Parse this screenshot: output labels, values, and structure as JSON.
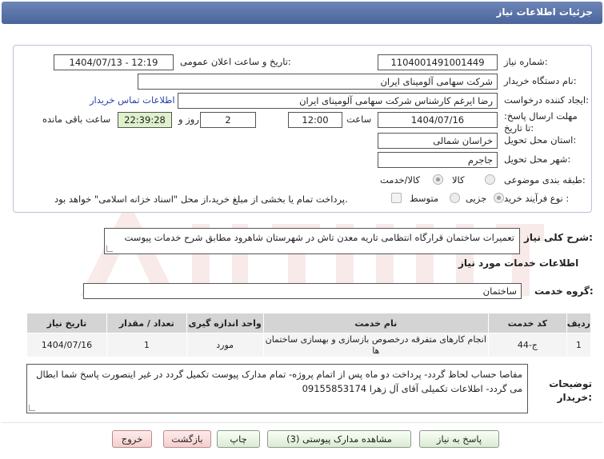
{
  "header": {
    "title": "جزئیات اطلاعات نیاز"
  },
  "form": {
    "need_number_label": "شماره نیاز:",
    "need_number": "1104001491001449",
    "announce_label": "تاریخ و ساعت اعلان عمومی:",
    "announce_value": "1404/07/13 - 12:19",
    "buyer_label": "نام دستگاه خریدار:",
    "buyer_value": "شرکت سهامی آلومینای ایران",
    "creator_label": "ایجاد کننده درخواست:",
    "creator_value": "رضا ایرغم کارشناس شرکت سهامی آلومینای ایران",
    "contact_link": "اطلاعات تماس خریدار",
    "deadline_label": "مهلت ارسال پاسخ: تا تاریخ:",
    "deadline_date": "1404/07/16",
    "time_label": "ساعت",
    "deadline_time": "12:00",
    "day_and_label": "روز و",
    "days_value": "2",
    "remaining_time": "22:39:28",
    "remaining_label": "ساعت باقی مانده",
    "province_label": "استان محل تحویل:",
    "province_value": "خراسان شمالی",
    "city_label": "شهر محل تحویل:",
    "city_value": "جاجرم",
    "category_label": "طبقه بندی موضوعی:",
    "category_options": [
      "کالا",
      "کالا/خدمت"
    ],
    "process_label": "نوع فرآیند خرید :",
    "process_options": [
      "جزیی",
      "متوسط"
    ],
    "payment_note": "پرداخت تمام یا بخشی از مبلغ خرید،از محل \"اسناد خزانه اسلامی\" خواهد بود."
  },
  "summary": {
    "label": "شرح کلی نیاز:",
    "value": "تعمیرات ساختمان قرارگاه انتظامی تاریه معدن تاش در شهرستان شاهرود مطابق شرح خدمات پیوست"
  },
  "services": {
    "section_title": "اطلاعات خدمات مورد نیاز",
    "group_label": "گروه خدمت:",
    "group_value": "ساختمان",
    "columns": [
      "ردیف",
      "کد خدمت",
      "نام خدمت",
      "واحد اندازه گیری",
      "تعداد / مقدار",
      "تاریخ نیاز"
    ],
    "rows": [
      {
        "row": "1",
        "code": "ج-44",
        "name": "انجام کارهای متفرقه درخصوص بازسازی و بهسازی ساختمان ها",
        "unit": "مورد",
        "qty": "1",
        "date": "1404/07/16"
      }
    ]
  },
  "buyer_notes": {
    "label": "توضیحات خریدار:",
    "value": "مفاصا حساب لحاظ گردد- پرداخت دو ماه پس از اتمام پروژه- تمام مدارک پیوست تکمیل گردد در غیر اینصورت پاسخ شما ابطال می گردد- اطلاعات تکمیلی آقای آل زهرا 09155853174"
  },
  "buttons": {
    "reply": "پاسخ به نیاز",
    "attachments": "مشاهده مدارک پیوستی (3)",
    "print": "چاپ",
    "back": "بازگشت",
    "exit": "خروج"
  },
  "colors": {
    "header": "#5a74aa",
    "highlight": "#dff0cc",
    "link": "#2a3fa6"
  }
}
